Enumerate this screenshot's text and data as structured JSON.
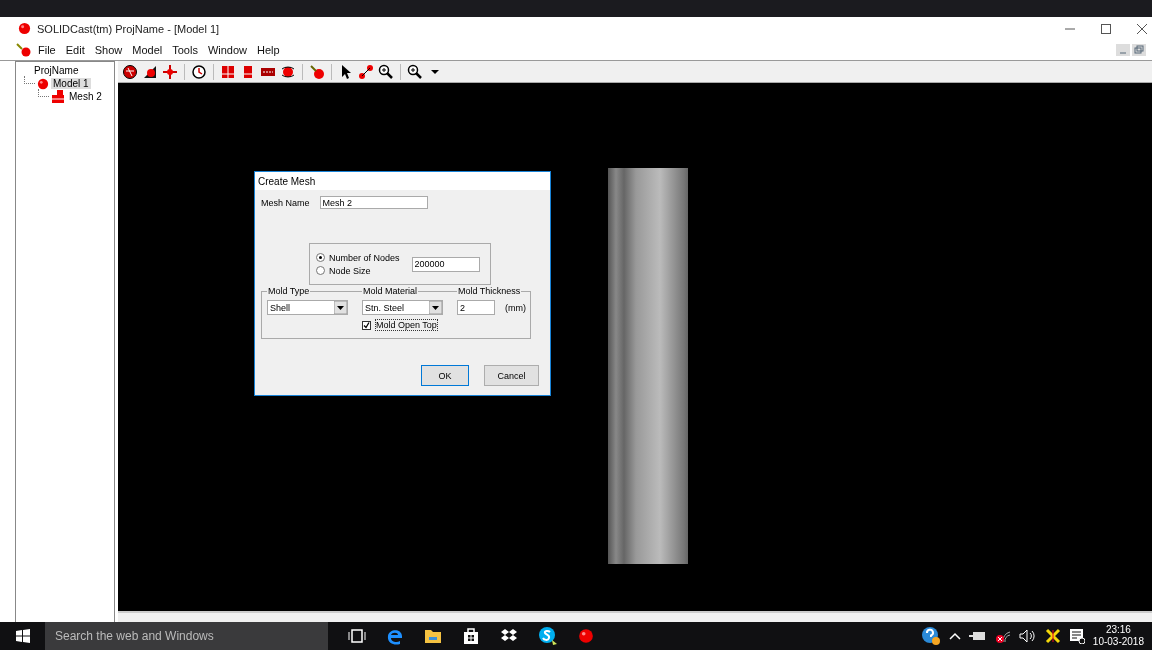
{
  "window": {
    "title": "SOLIDCast(tm) ProjName - [Model 1]"
  },
  "menu": [
    "File",
    "Edit",
    "Show",
    "Model",
    "Tools",
    "Window",
    "Help"
  ],
  "tree": {
    "label": "ProjName",
    "children": [
      {
        "label": "Model 1",
        "selected": true,
        "children": [
          {
            "label": "Mesh 2",
            "selected": false
          }
        ]
      }
    ]
  },
  "dialog": {
    "title": "Create Mesh",
    "mesh_name": {
      "label": "Mesh Name",
      "value": "Mesh 2"
    },
    "node_options": [
      {
        "label": "Number of Nodes",
        "selected": true
      },
      {
        "label": "Node Size",
        "selected": false
      }
    ],
    "nodes_value": "200000",
    "mold_type": {
      "label": "Mold Type",
      "value": "Shell"
    },
    "mold_material": {
      "label": "Mold Material",
      "value": "Stn. Steel"
    },
    "mold_thickness": {
      "label": "Mold Thickness",
      "value": "2",
      "unit": "(mm)"
    },
    "mold_open_top": {
      "label": "Mold Open Top",
      "checked": true
    },
    "buttons": [
      "OK",
      "Cancel"
    ]
  },
  "taskbar": {
    "search": {
      "placeholder": "Search the web and Windows"
    },
    "time": "23:16",
    "date": "10-03-2018"
  }
}
